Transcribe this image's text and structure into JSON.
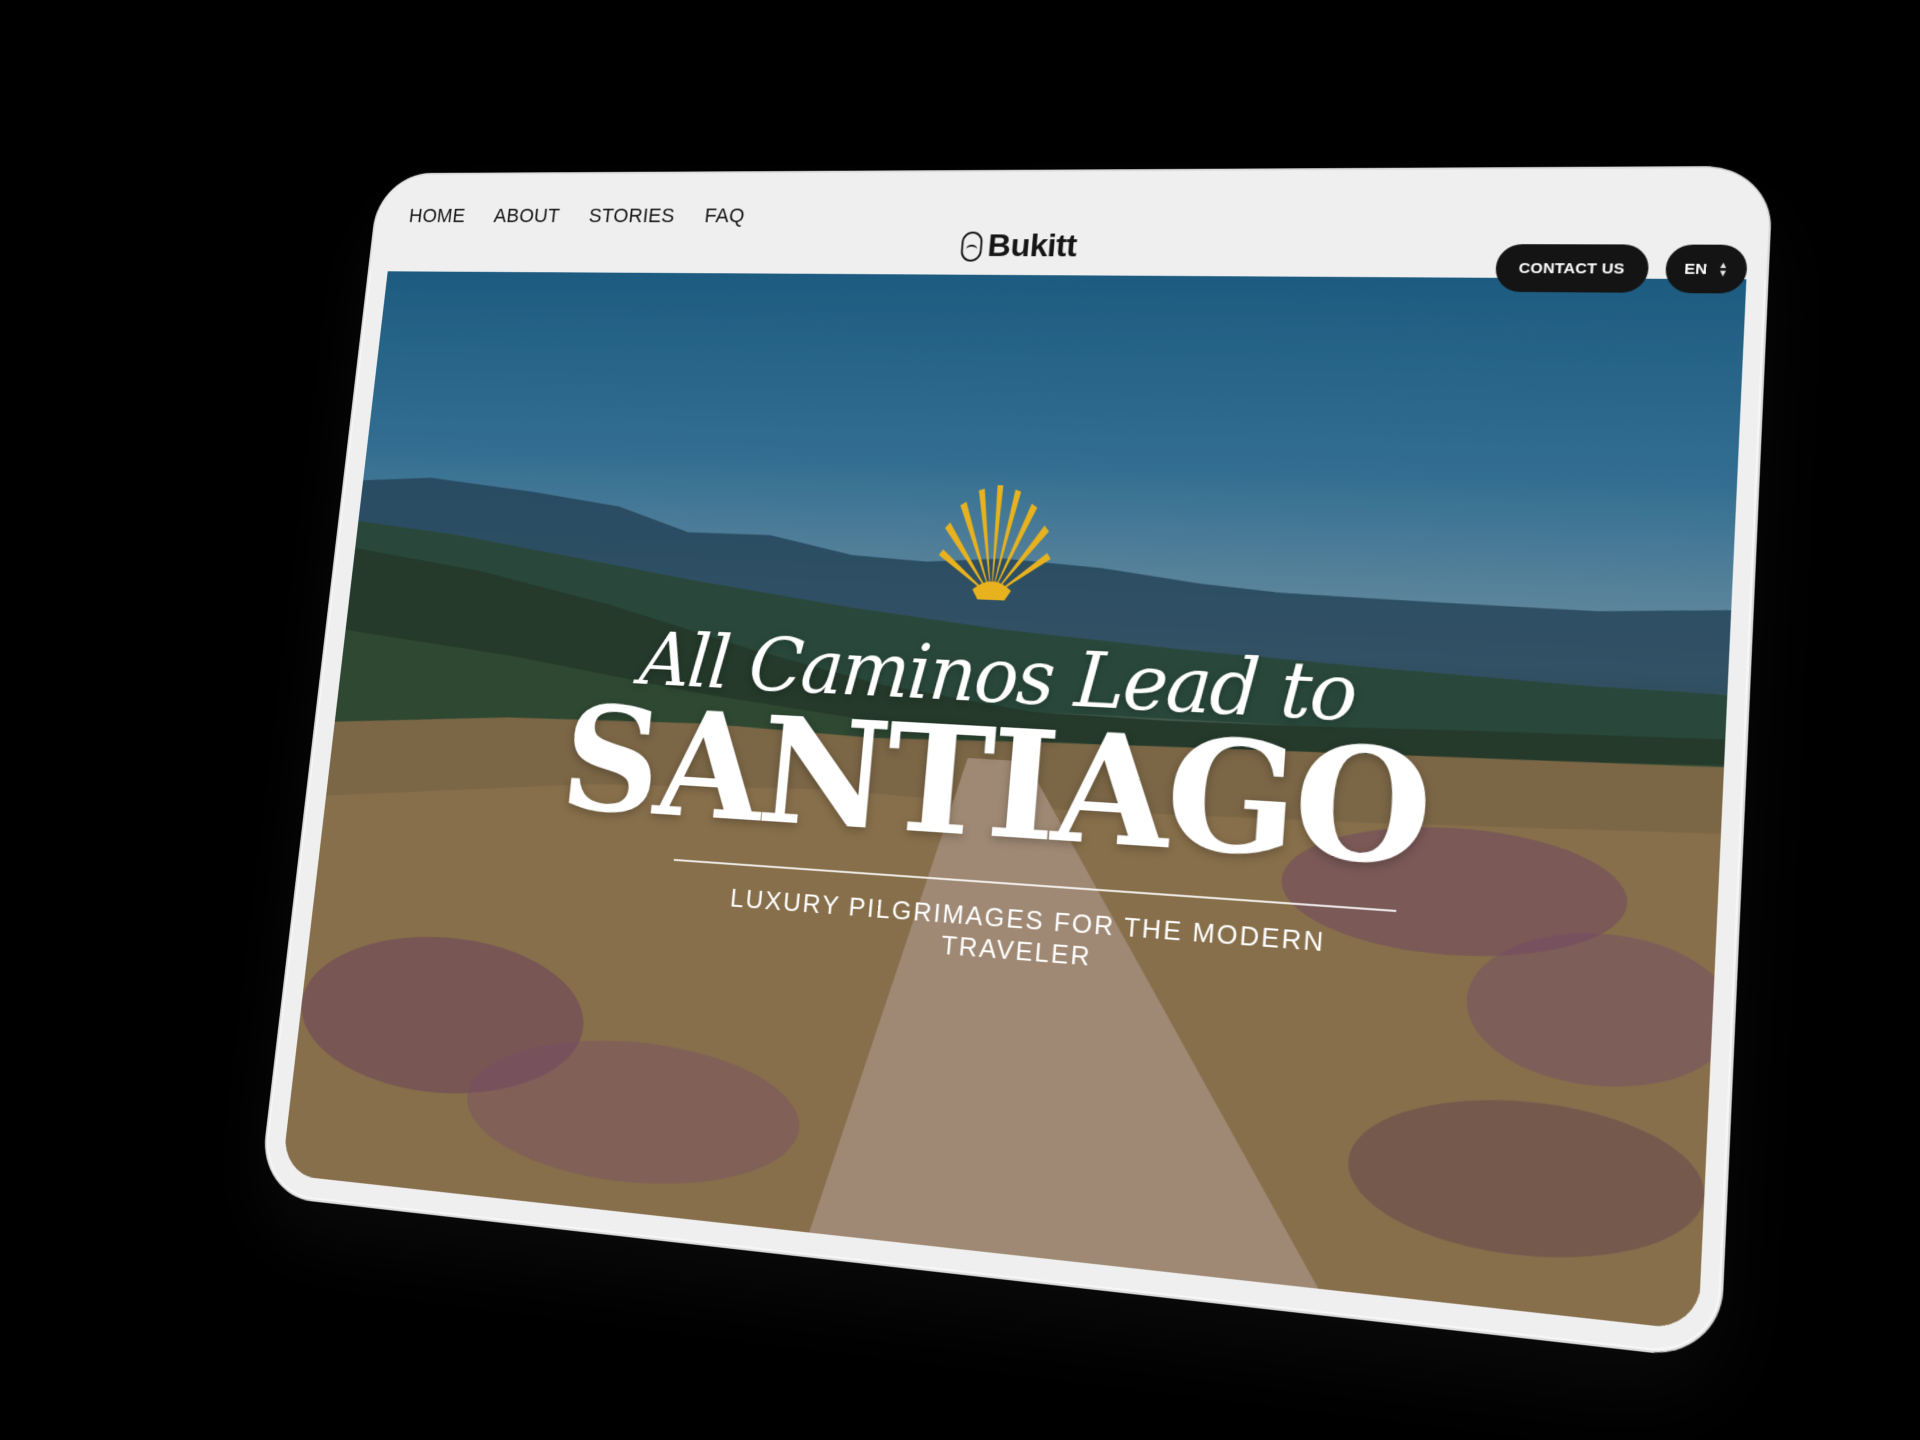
{
  "nav": {
    "links": [
      "HOME",
      "ABOUT",
      "STORIES",
      "FAQ"
    ]
  },
  "brand": {
    "name": "Bukitt"
  },
  "header": {
    "contact_label": "CONTACT US",
    "language_label": "EN"
  },
  "hero": {
    "headline": "All Caminos Lead to",
    "title": "SANTIAGO",
    "tagline": "LUXURY PILGRIMAGES FOR THE MODERN TRAVELER"
  },
  "colors": {
    "shell_accent": "#e8b21e",
    "nav_text": "#161616",
    "button_bg": "#141414",
    "frame": "#efefef"
  },
  "icons": [
    "scallop-shell-icon",
    "bukitt-logo-icon",
    "select-chevrons-icon"
  ]
}
